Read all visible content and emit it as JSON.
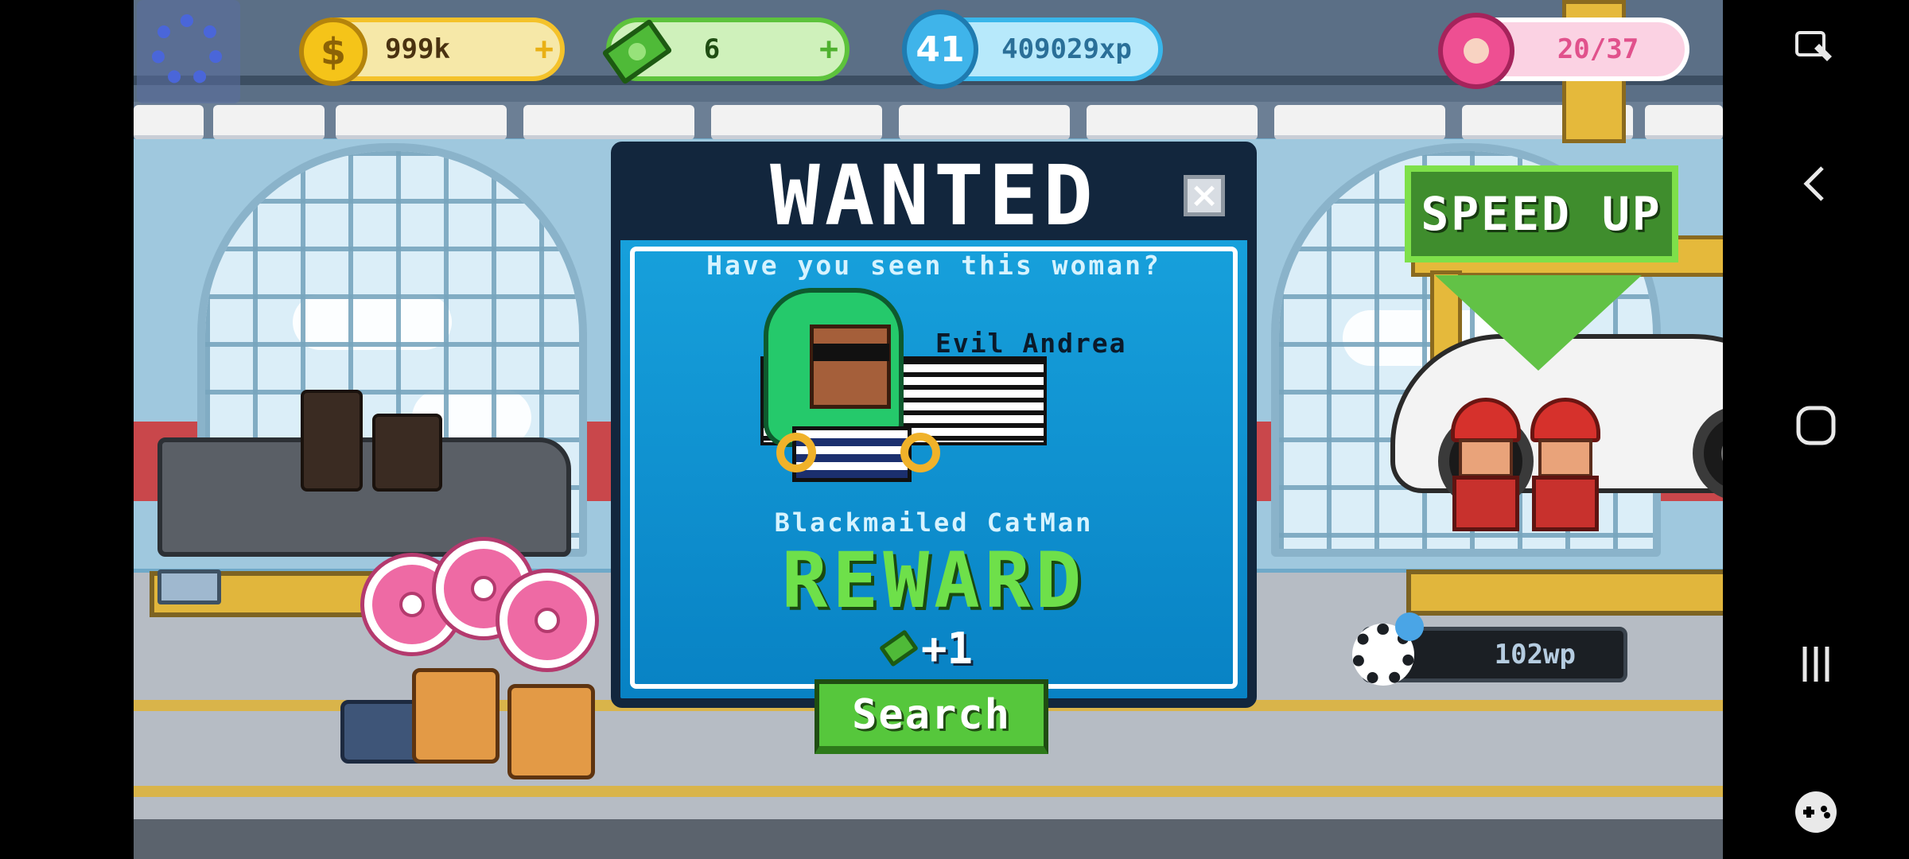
{
  "hud": {
    "coins": "999k",
    "coins_plus": "+",
    "coin_symbol": "$",
    "cash": "6",
    "cash_plus": "+",
    "level": "41",
    "xp": "409029xp",
    "donuts": "20/37"
  },
  "dialog": {
    "title": "WANTED",
    "close_label": "×",
    "subtitle": "Have you seen this woman?",
    "suspect_name": "Evil Andrea",
    "crime": "Blackmailed CatMan",
    "reward_label": "REWARD",
    "reward_amount": "+1",
    "search_label": "Search"
  },
  "station": {
    "speed_up_label": "SPEED UP",
    "wp_label": "102wp"
  },
  "navbar": {
    "icons": [
      "screenshot-edit-icon",
      "back-icon",
      "home-icon",
      "recents-icon",
      "game-tools-icon"
    ]
  },
  "colors": {
    "dialog_bg": "#0f9ad8",
    "reward_green": "#6ee04a",
    "speed_up_green": "#3f8d2d"
  }
}
